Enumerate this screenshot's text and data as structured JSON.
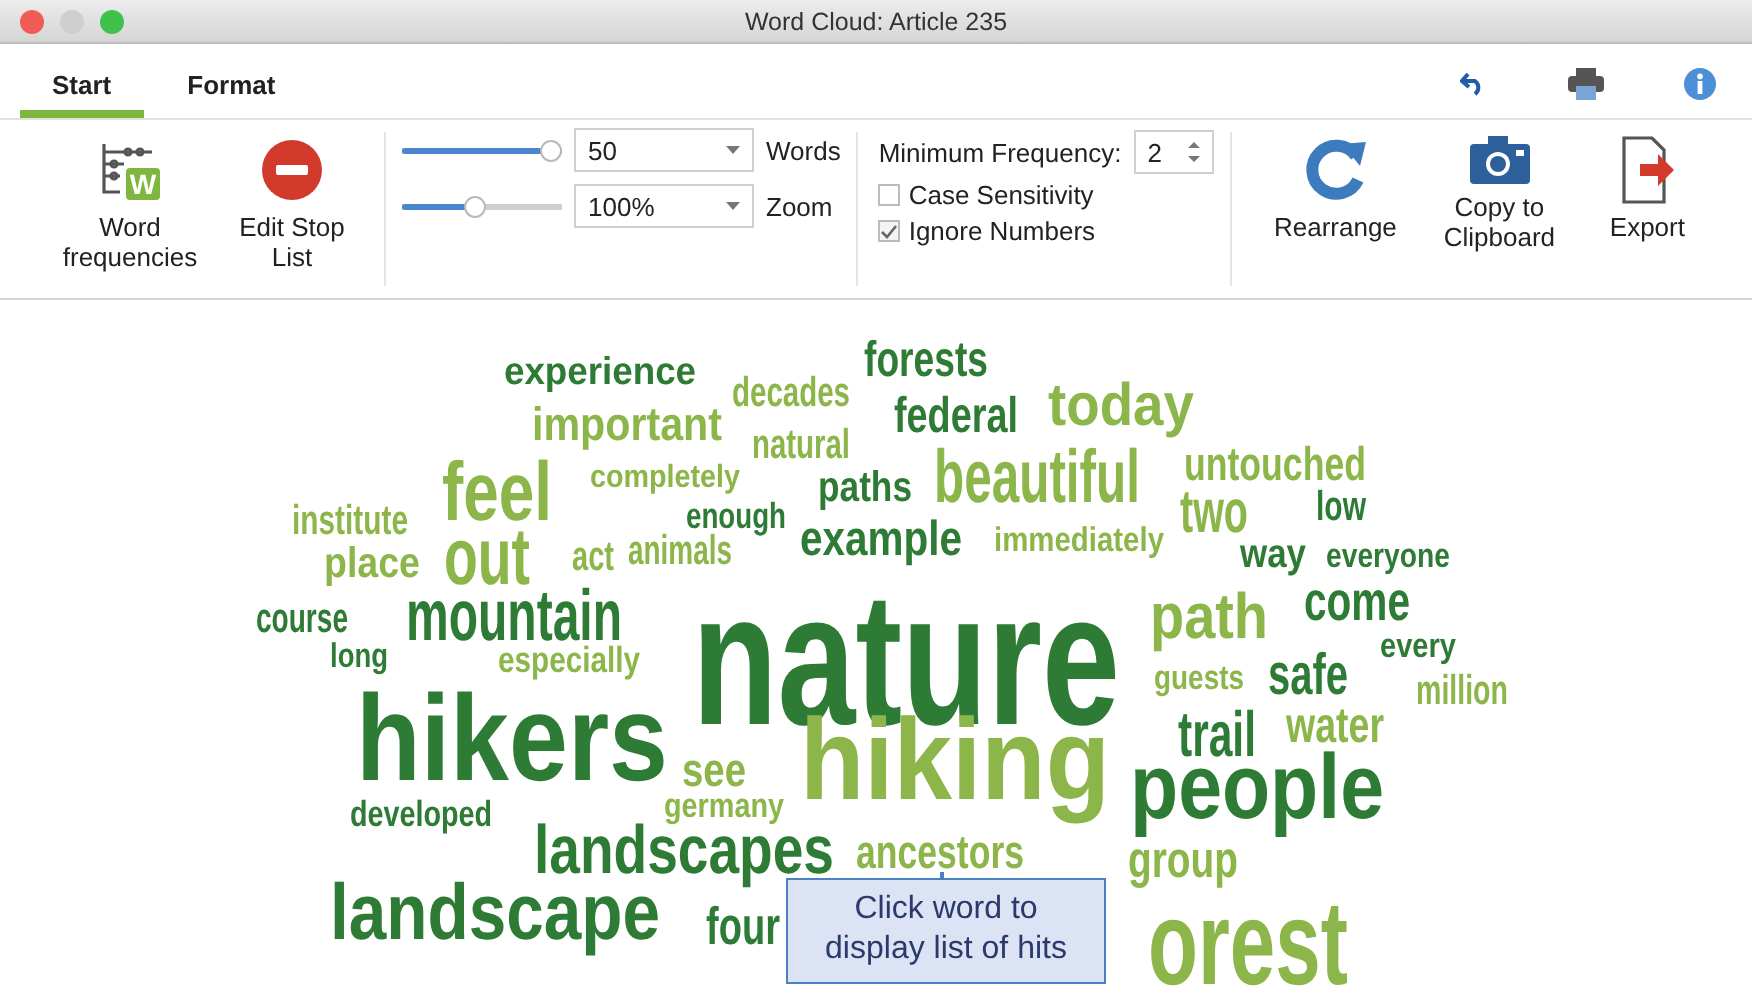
{
  "window": {
    "title": "Word Cloud: Article 235"
  },
  "tabs": [
    {
      "label": "Start",
      "selected": true
    },
    {
      "label": "Format",
      "selected": false
    }
  ],
  "ribbon": {
    "left_buttons": [
      {
        "kind": "word-frequencies",
        "label": "Word frequencies",
        "icon_letter": "W"
      },
      {
        "kind": "stop-list",
        "label": "Edit Stop List"
      }
    ],
    "sliders": [
      {
        "level": 1,
        "value": "50",
        "label": "Words"
      },
      {
        "level": 0.45,
        "value": "100%",
        "label": "Zoom"
      }
    ],
    "min_frequency": {
      "label": "Minimum Frequency:",
      "value": "2"
    },
    "options": [
      {
        "label": "Case Sensitivity",
        "checked": false
      },
      {
        "label": "Ignore Numbers",
        "checked": true
      }
    ],
    "right_buttons": [
      {
        "kind": "rearrange",
        "label": "Rearrange"
      },
      {
        "kind": "copy",
        "label": "Copy to Clipboard"
      },
      {
        "kind": "export",
        "label": "Export"
      }
    ]
  },
  "words": [
    {
      "text": "experience",
      "color": "#2e7b36"
    },
    {
      "text": "decades",
      "color": "#8cb64a"
    },
    {
      "text": "forests",
      "color": "#2e7b36"
    },
    {
      "text": "important",
      "color": "#8cb64a"
    },
    {
      "text": "natural",
      "color": "#8cb64a"
    },
    {
      "text": "federal",
      "color": "#2e7b36"
    },
    {
      "text": "today",
      "color": "#8cb64a"
    },
    {
      "text": "beautiful",
      "color": "#8cb64a"
    },
    {
      "text": "untouched",
      "color": "#8cb64a"
    },
    {
      "text": "institute",
      "color": "#8cb64a"
    },
    {
      "text": "feel",
      "color": "#8cb64a"
    },
    {
      "text": "completely",
      "color": "#8cb64a"
    },
    {
      "text": "enough",
      "color": "#2e7b36"
    },
    {
      "text": "paths",
      "color": "#2e7b36"
    },
    {
      "text": "two",
      "color": "#8cb64a"
    },
    {
      "text": "low",
      "color": "#2e7b36"
    },
    {
      "text": "place",
      "color": "#8cb64a"
    },
    {
      "text": "out",
      "color": "#8cb64a"
    },
    {
      "text": "act",
      "color": "#8cb64a"
    },
    {
      "text": "animals",
      "color": "#8cb64a"
    },
    {
      "text": "example",
      "color": "#2e7b36"
    },
    {
      "text": "immediately",
      "color": "#8cb64a"
    },
    {
      "text": "way",
      "color": "#2e7b36"
    },
    {
      "text": "everyone",
      "color": "#2e7b36"
    },
    {
      "text": "course",
      "color": "#2e7b36"
    },
    {
      "text": "mountain",
      "color": "#2e7b36"
    },
    {
      "text": "nature",
      "color": "#2e7b36"
    },
    {
      "text": "path",
      "color": "#8cb64a"
    },
    {
      "text": "come",
      "color": "#2e7b36"
    },
    {
      "text": "long",
      "color": "#2e7b36"
    },
    {
      "text": "especially",
      "color": "#8cb64a"
    },
    {
      "text": "guests",
      "color": "#8cb64a"
    },
    {
      "text": "safe",
      "color": "#2e7b36"
    },
    {
      "text": "every",
      "color": "#2e7b36"
    },
    {
      "text": "million",
      "color": "#8cb64a"
    },
    {
      "text": "hikers",
      "color": "#2e7b36"
    },
    {
      "text": "see",
      "color": "#8cb64a"
    },
    {
      "text": "hiking",
      "color": "#8cb64a"
    },
    {
      "text": "trail",
      "color": "#2e7b36"
    },
    {
      "text": "water",
      "color": "#8cb64a"
    },
    {
      "text": "developed",
      "color": "#2e7b36"
    },
    {
      "text": "germany",
      "color": "#8cb64a"
    },
    {
      "text": "people",
      "color": "#2e7b36"
    },
    {
      "text": "landscapes",
      "color": "#2e7b36"
    },
    {
      "text": "ancestors",
      "color": "#8cb64a"
    },
    {
      "text": "group",
      "color": "#8cb64a"
    },
    {
      "text": "landscape",
      "color": "#2e7b36"
    },
    {
      "text": "four",
      "color": "#2e7b36"
    },
    {
      "text": "orest",
      "color": "#8cb64a"
    }
  ],
  "callout": {
    "text": "Click word to display list of hits"
  }
}
